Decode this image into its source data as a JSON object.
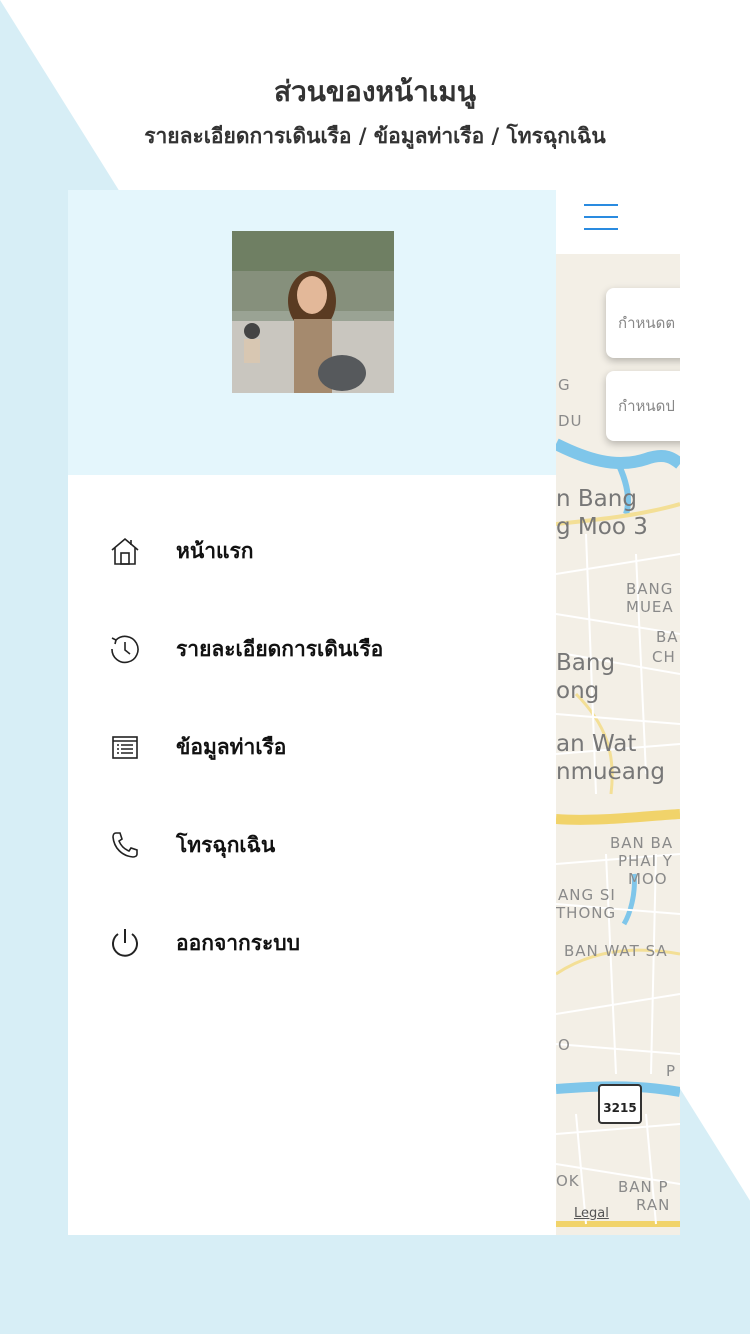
{
  "header": {
    "title": "ส่วนของหน้าเมนู",
    "subtitle": "รายละเอียดการเดินเรือ / ข้อมูลท่าเรือ / โทรฉุกเฉิน"
  },
  "drawer": {
    "menu": [
      {
        "label": "หน้าแรก",
        "icon": "home-icon"
      },
      {
        "label": "รายละเอียดการเดินเรือ",
        "icon": "history-clock-icon"
      },
      {
        "label": "ข้อมูลท่าเรือ",
        "icon": "list-icon"
      },
      {
        "label": "โทรฉุกเฉิน",
        "icon": "phone-icon"
      },
      {
        "label": "ออกจากระบบ",
        "icon": "power-icon"
      }
    ]
  },
  "map": {
    "field_1_placeholder": "กำหนดต",
    "field_2_placeholder": "กำหนดป",
    "labels": [
      "G",
      "DU",
      "n Bang",
      "g Moo 3",
      "BANG",
      "MUEA",
      "BA",
      "CH",
      "Bang",
      "ong",
      "an Wat",
      "nmueang",
      "BAN BA",
      "PHAI Y",
      "MOO",
      "ANG SI",
      "THONG",
      "BAN WAT SA",
      "O",
      "P",
      "OK",
      "BAN P",
      "RAN"
    ],
    "route_number": "3215",
    "legal_label": "Legal"
  },
  "colors": {
    "accent": "#2a8be0",
    "drawer_header_bg": "#e4f6fc",
    "page_bg_tint": "#d7eef6"
  }
}
